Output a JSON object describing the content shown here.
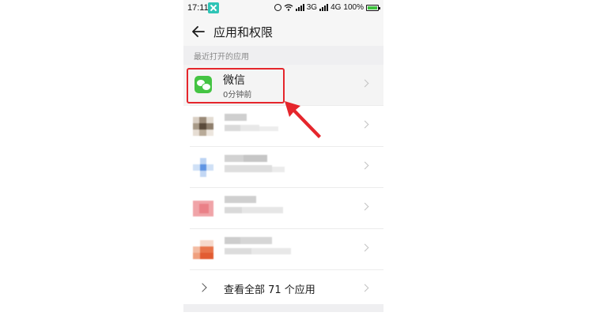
{
  "status_bar": {
    "time": "17:11",
    "network": "3G",
    "network2": "4G",
    "battery": "100%"
  },
  "header": {
    "title": "应用和权限"
  },
  "section": {
    "label": "最近打开的应用"
  },
  "apps": [
    {
      "name": "微信",
      "subtitle": "0分钟前",
      "icon": "wechat-icon"
    }
  ],
  "view_all": {
    "label": "查看全部 71 个应用"
  },
  "colors": {
    "highlight": "#e5262c",
    "wechat_green": "#44c443"
  }
}
